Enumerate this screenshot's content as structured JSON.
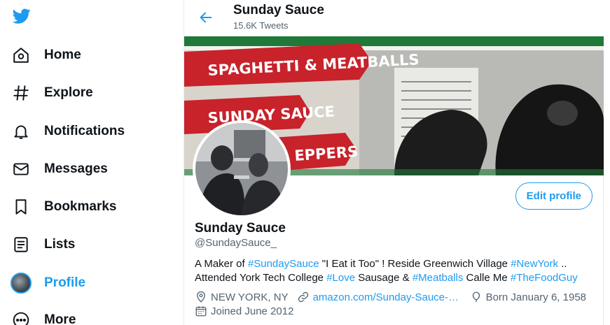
{
  "sidebar": {
    "logo_icon": "twitter-bird-icon",
    "items": [
      {
        "label": "Home",
        "icon": "home-icon"
      },
      {
        "label": "Explore",
        "icon": "hashtag-icon"
      },
      {
        "label": "Notifications",
        "icon": "bell-icon"
      },
      {
        "label": "Messages",
        "icon": "envelope-icon"
      },
      {
        "label": "Bookmarks",
        "icon": "bookmark-icon"
      },
      {
        "label": "Lists",
        "icon": "list-icon"
      },
      {
        "label": "Profile",
        "icon": "avatar"
      },
      {
        "label": "More",
        "icon": "more-circle-icon"
      }
    ],
    "active_item": "Profile"
  },
  "header": {
    "name": "Sunday Sauce",
    "tweet_count": "15.6K Tweets",
    "back_icon": "back-arrow-icon"
  },
  "banner": {
    "lines": [
      "SPAGHETTI & MEATBALLS",
      "SUNDAY SAUCE",
      "EPPERS"
    ]
  },
  "profile": {
    "edit_label": "Edit profile",
    "display_name": "Sunday Sauce",
    "handle": "@SundaySauce_",
    "bio": {
      "p1": "A Maker of ",
      "tag1": "#SundaySauce",
      "p2": "  \"I Eat it Too\" ! Reside Greenwich Village ",
      "tag2": "#NewYork",
      "p3": " .. Attended  York Tech College ",
      "tag3": "#Love",
      "p4": " Sausage & ",
      "tag4": "#Meatballs",
      "p5": "  Calle Me ",
      "tag5": "#TheFoodGuy"
    },
    "location": "NEW YORK, NY",
    "website": "amazon.com/Sunday-Sauce-W...",
    "birthday": "Born January 6, 1958",
    "joined": "Joined June 2012"
  },
  "colors": {
    "accent": "#1d9bf0",
    "text": "#0f1419",
    "muted": "#536471"
  }
}
